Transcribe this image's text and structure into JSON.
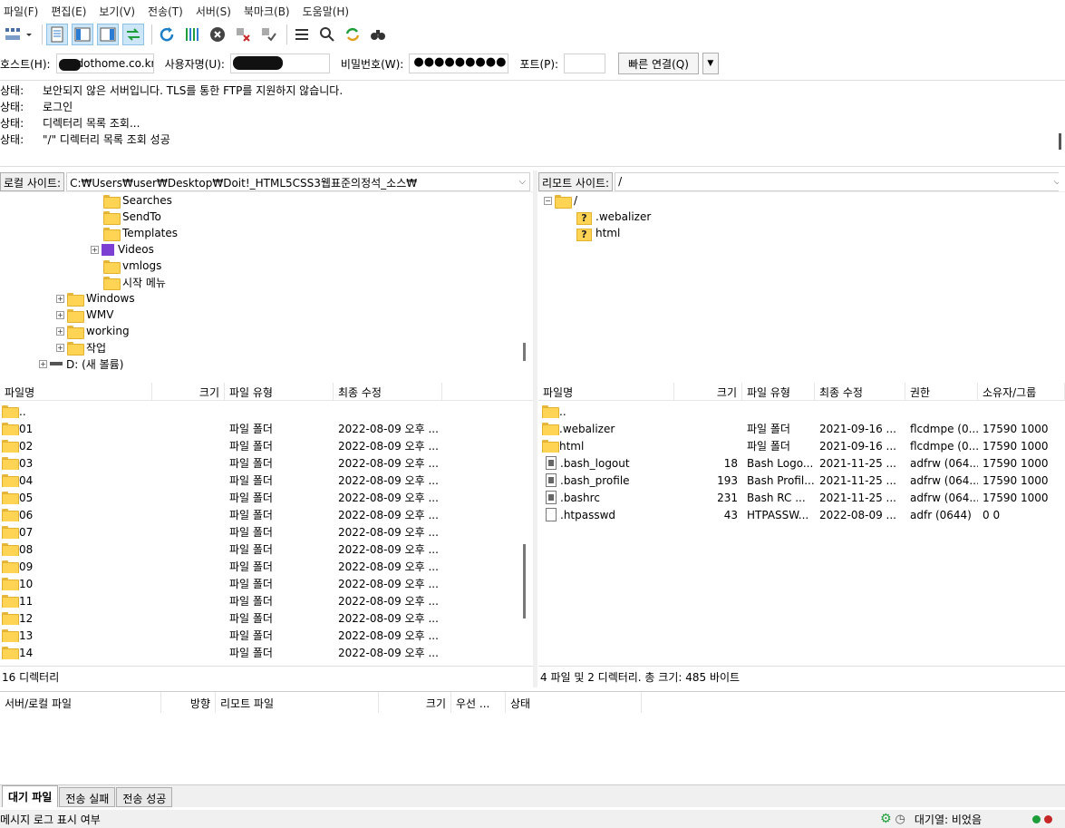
{
  "menu": [
    "파일(F)",
    "편집(E)",
    "보기(V)",
    "전송(T)",
    "서버(S)",
    "북마크(B)",
    "도움말(H)"
  ],
  "toolbar_icons": [
    "site-manager-icon",
    "dropdown-arrow-icon",
    "message-log-icon",
    "local-tree-icon",
    "remote-tree-icon",
    "transfer-queue-icon",
    "refresh-icon",
    "process-queue-icon",
    "cancel-icon",
    "disconnect-icon",
    "reconnect-icon",
    "directory-comparison-icon",
    "filter-icon",
    "sync-browsing-icon",
    "search-icon"
  ],
  "quickconnect": {
    "host_label": "호스트(H):",
    "host_value": "dothome.co.kr",
    "user_label": "사용자명(U):",
    "user_value": "",
    "pass_label": "비밀번호(W):",
    "pass_value": "●●●●●●●●●",
    "port_label": "포트(P):",
    "port_value": "",
    "connect_label": "빠른 연결(Q)"
  },
  "log": [
    {
      "key": "상태:",
      "msg": "보안되지 않은 서버입니다. TLS를 통한 FTP를 지원하지 않습니다."
    },
    {
      "key": "상태:",
      "msg": "로그인"
    },
    {
      "key": "상태:",
      "msg": "디렉터리 목록 조회..."
    },
    {
      "key": "상태:",
      "msg": "\"/\" 디렉터리 목록 조회 성공"
    }
  ],
  "local": {
    "site_label": "로컬 사이트:",
    "path": "C:₩Users₩user₩Desktop₩Doit!_HTML5CSS3웹표준의정석_소스₩",
    "tree": [
      {
        "label": "Searches"
      },
      {
        "label": "SendTo"
      },
      {
        "label": "Templates"
      },
      {
        "label": "Videos"
      },
      {
        "label": "vmlogs"
      },
      {
        "label": "시작 메뉴"
      },
      {
        "label": "Windows"
      },
      {
        "label": "WMV"
      },
      {
        "label": "working"
      },
      {
        "label": "작업"
      },
      {
        "label": "D: (새 볼륨)"
      }
    ],
    "columns": [
      "파일명",
      "크기",
      "파일 유형",
      "최종 수정"
    ],
    "files": [
      {
        "name": "..",
        "size": "",
        "type": "",
        "modified": ""
      },
      {
        "name": "01",
        "size": "",
        "type": "파일 폴더",
        "modified": "2022-08-09 오후 ..."
      },
      {
        "name": "02",
        "size": "",
        "type": "파일 폴더",
        "modified": "2022-08-09 오후 ..."
      },
      {
        "name": "03",
        "size": "",
        "type": "파일 폴더",
        "modified": "2022-08-09 오후 ..."
      },
      {
        "name": "04",
        "size": "",
        "type": "파일 폴더",
        "modified": "2022-08-09 오후 ..."
      },
      {
        "name": "05",
        "size": "",
        "type": "파일 폴더",
        "modified": "2022-08-09 오후 ..."
      },
      {
        "name": "06",
        "size": "",
        "type": "파일 폴더",
        "modified": "2022-08-09 오후 ..."
      },
      {
        "name": "07",
        "size": "",
        "type": "파일 폴더",
        "modified": "2022-08-09 오후 ..."
      },
      {
        "name": "08",
        "size": "",
        "type": "파일 폴더",
        "modified": "2022-08-09 오후 ..."
      },
      {
        "name": "09",
        "size": "",
        "type": "파일 폴더",
        "modified": "2022-08-09 오후 ..."
      },
      {
        "name": "10",
        "size": "",
        "type": "파일 폴더",
        "modified": "2022-08-09 오후 ..."
      },
      {
        "name": "11",
        "size": "",
        "type": "파일 폴더",
        "modified": "2022-08-09 오후 ..."
      },
      {
        "name": "12",
        "size": "",
        "type": "파일 폴더",
        "modified": "2022-08-09 오후 ..."
      },
      {
        "name": "13",
        "size": "",
        "type": "파일 폴더",
        "modified": "2022-08-09 오후 ..."
      },
      {
        "name": "14",
        "size": "",
        "type": "파일 폴더",
        "modified": "2022-08-09 오후 ..."
      }
    ],
    "status": "16 디렉터리"
  },
  "remote": {
    "site_label": "리모트 사이트:",
    "path": "/",
    "tree": [
      {
        "label": "/"
      },
      {
        "label": ".webalizer"
      },
      {
        "label": "html"
      }
    ],
    "columns": [
      "파일명",
      "크기",
      "파일 유형",
      "최종 수정",
      "권한",
      "소유자/그룹"
    ],
    "files": [
      {
        "name": "..",
        "size": "",
        "type": "",
        "modified": "",
        "perm": "",
        "owner": "",
        "icon": "folder"
      },
      {
        "name": ".webalizer",
        "size": "",
        "type": "파일 폴더",
        "modified": "2021-09-16 ...",
        "perm": "flcdmpe (0...",
        "owner": "17590 1000",
        "icon": "folder"
      },
      {
        "name": "html",
        "size": "",
        "type": "파일 폴더",
        "modified": "2021-09-16 ...",
        "perm": "flcdmpe (0...",
        "owner": "17590 1000",
        "icon": "folder"
      },
      {
        "name": ".bash_logout",
        "size": "18",
        "type": "Bash Logo...",
        "modified": "2021-11-25 ...",
        "perm": "adfrw (064...",
        "owner": "17590 1000",
        "icon": "bash"
      },
      {
        "name": ".bash_profile",
        "size": "193",
        "type": "Bash Profil...",
        "modified": "2021-11-25 ...",
        "perm": "adfrw (064...",
        "owner": "17590 1000",
        "icon": "bash"
      },
      {
        "name": ".bashrc",
        "size": "231",
        "type": "Bash RC ...",
        "modified": "2021-11-25 ...",
        "perm": "adfrw (064...",
        "owner": "17590 1000",
        "icon": "bash"
      },
      {
        "name": ".htpasswd",
        "size": "43",
        "type": "HTPASSW...",
        "modified": "2022-08-09 ...",
        "perm": "adfr (0644)",
        "owner": "0 0",
        "icon": "file"
      }
    ],
    "status": "4 파일 및 2 디렉터리. 총 크기: 485 바이트"
  },
  "queue": {
    "columns": [
      "서버/로컬 파일",
      "방향",
      "리모트 파일",
      "크기",
      "우선 ...",
      "상태"
    ],
    "tabs": [
      "대기 파일",
      "전송 실패",
      "전송 성공"
    ]
  },
  "statusbar": {
    "left": "메시지 로그 표시 여부",
    "queue": "대기열: 비었음"
  },
  "colors": {
    "folder": "#ffd354",
    "accent": "#2b7cd3",
    "green": "#1e9e3a",
    "red": "#c62828"
  }
}
